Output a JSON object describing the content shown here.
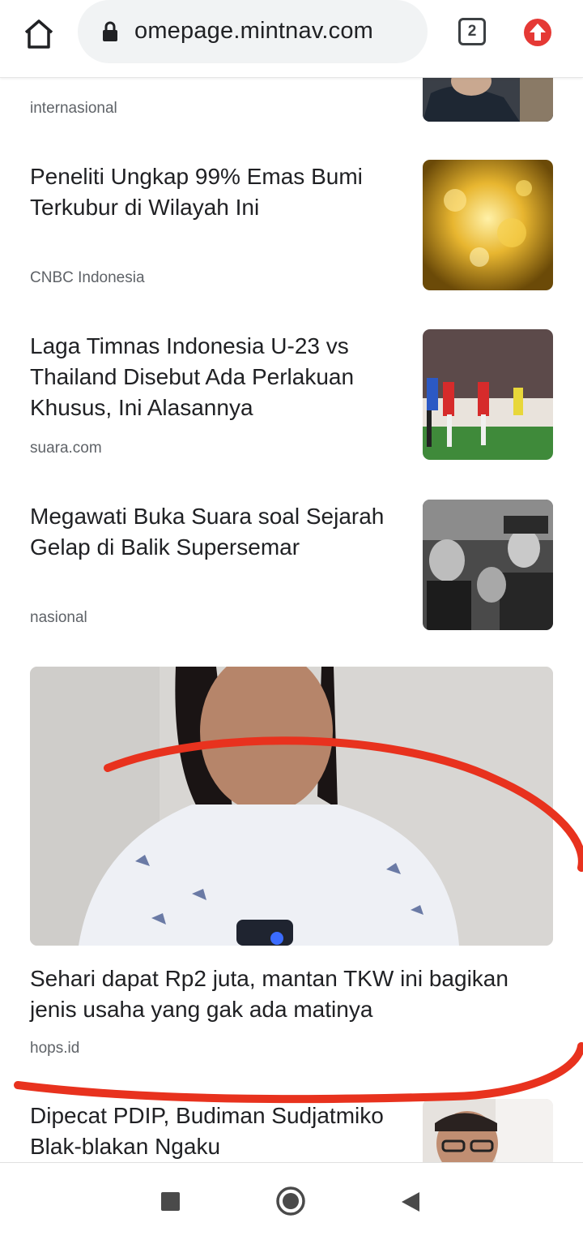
{
  "browser": {
    "url": "omepage.mintnav.com",
    "tab_count": "2",
    "icons": {
      "home": "home-icon",
      "lock": "lock-icon",
      "update": "update-arrow-icon"
    }
  },
  "articles": [
    {
      "title": "",
      "source": "internasional"
    },
    {
      "title": "Peneliti Ungkap 99% Emas Bumi Terkubur di Wilayah Ini",
      "source": "CNBC Indonesia"
    },
    {
      "title": "Laga Timnas Indonesia U-23 vs Thailand Disebut Ada Perlakuan Khusus, Ini Alasannya",
      "source": "suara.com"
    },
    {
      "title": "Megawati Buka Suara soal Sejarah Gelap di Balik Supersemar",
      "source": "nasional"
    },
    {
      "title": "Dipecat PDIP, Budiman Sudjatmiko Blak-blakan Ngaku",
      "source": ""
    }
  ],
  "featured": {
    "title": "Sehari dapat Rp2 juta, mantan TKW ini bagikan jenis usaha yang gak ada matinya",
    "source": "hops.id"
  },
  "annotation_color": "#e8321e",
  "colors": {
    "accent_update": "#e53935",
    "text_primary": "#202124",
    "text_secondary": "#5f6368"
  }
}
